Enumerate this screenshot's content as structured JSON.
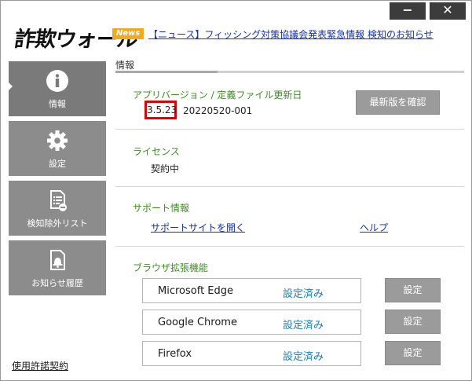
{
  "window": {
    "minimize_label": "−",
    "close_label": "✕"
  },
  "app": {
    "logo": "詐欺ウォール"
  },
  "news": {
    "badge": "News",
    "link_text": "【ニュース】フィッシング対策協議会発表緊急情報 検知のお知らせ"
  },
  "sidebar": {
    "items": [
      {
        "label": "情報",
        "icon": "info-icon",
        "active": true
      },
      {
        "label": "設定",
        "icon": "gear-icon",
        "active": false
      },
      {
        "label": "検知除外リスト",
        "icon": "exclusion-list-icon",
        "active": false
      },
      {
        "label": "お知らせ履歴",
        "icon": "bell-document-icon",
        "active": false
      }
    ],
    "license_link": "使用許諾契約"
  },
  "main": {
    "tab_label": "情報",
    "version_section": {
      "heading": "アプリバージョン / 定義ファイル更新日",
      "app_version": "3.5.23",
      "definition_date": "20220520-001",
      "update_button": "最新版を確認"
    },
    "license_section": {
      "heading": "ライセンス",
      "status": "契約中"
    },
    "support_section": {
      "heading": "サポート情報",
      "support_link": "サポートサイトを開く",
      "help_link": "ヘルプ"
    },
    "browser_section": {
      "heading": "ブラウザ拡張機能",
      "browsers": [
        {
          "name": "Microsoft Edge",
          "status": "設定済み",
          "button": "設定"
        },
        {
          "name": "Google Chrome",
          "status": "設定済み",
          "button": "設定"
        },
        {
          "name": "Firefox",
          "status": "設定済み",
          "button": "設定"
        }
      ]
    }
  },
  "colors": {
    "accent_green": "#3e8d20",
    "link_blue": "#1530c0",
    "status_blue": "#1a7fc2",
    "highlight_red": "#e00000",
    "news_orange": "#f4a91d",
    "sidebar_gray": "#8c8c8c"
  }
}
